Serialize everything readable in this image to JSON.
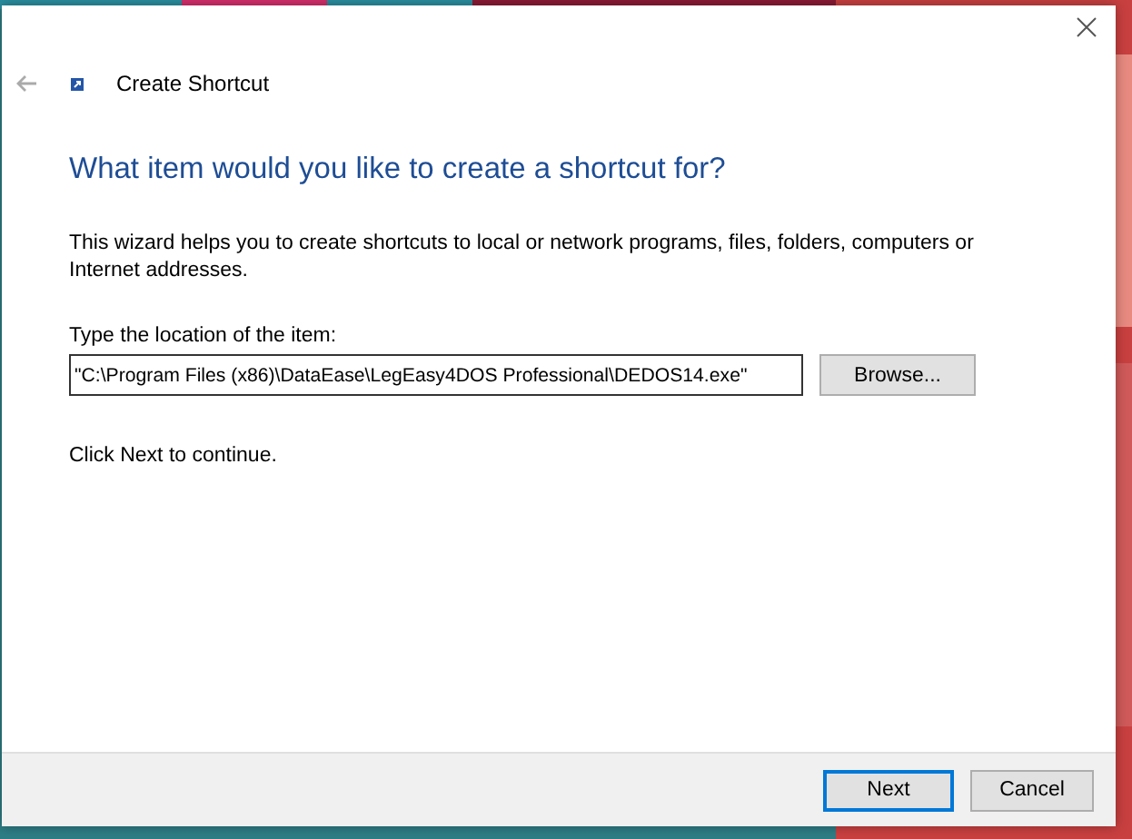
{
  "window": {
    "title": "Create Shortcut"
  },
  "heading": "What item would you like to create a shortcut for?",
  "description": "This wizard helps you to create shortcuts to local or network programs, files, folders, computers or Internet addresses.",
  "location": {
    "label": "Type the location of the item:",
    "value": "\"C:\\Program Files (x86)\\DataEase\\LegEasy4DOS Professional\\DEDOS14.exe\"",
    "browse": "Browse..."
  },
  "hint": "Click Next to continue.",
  "buttons": [
    {
      "label": "Next",
      "default": true
    },
    {
      "label": "Cancel",
      "default": false
    }
  ]
}
